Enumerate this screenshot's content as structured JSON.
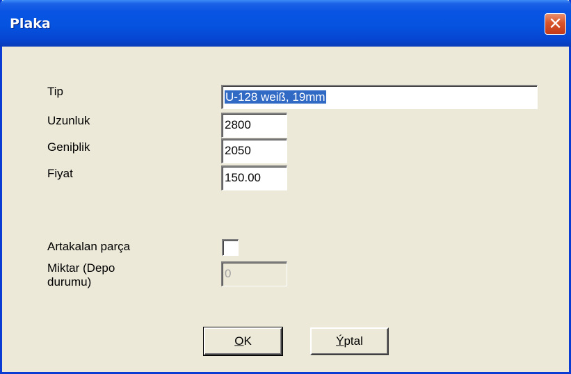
{
  "window": {
    "title": "Plaka"
  },
  "fields": {
    "tip": {
      "label": "Tip",
      "value": "U-128 weiß, 19mm"
    },
    "uzunluk": {
      "label": "Uzunluk",
      "value": "2800"
    },
    "genislik": {
      "label": "Geniþlik",
      "value": "2050"
    },
    "fiyat": {
      "label": "Fiyat",
      "value": "150.00"
    },
    "artakalan": {
      "label": "Artakalan parça",
      "checked": false
    },
    "miktar": {
      "label": "Miktar (Depo durumu)",
      "value": "0",
      "disabled": true
    }
  },
  "buttons": {
    "ok": {
      "label": "OK",
      "mnemonic": "O",
      "rest": "K"
    },
    "iptal": {
      "label": "Ýptal",
      "mnemonic": "Ý",
      "rest": "ptal"
    }
  },
  "colors": {
    "titlebar": "#0553e0",
    "dialog_bg": "#ece9d8",
    "selection": "#316ac5",
    "close_button": "#d8542a"
  }
}
